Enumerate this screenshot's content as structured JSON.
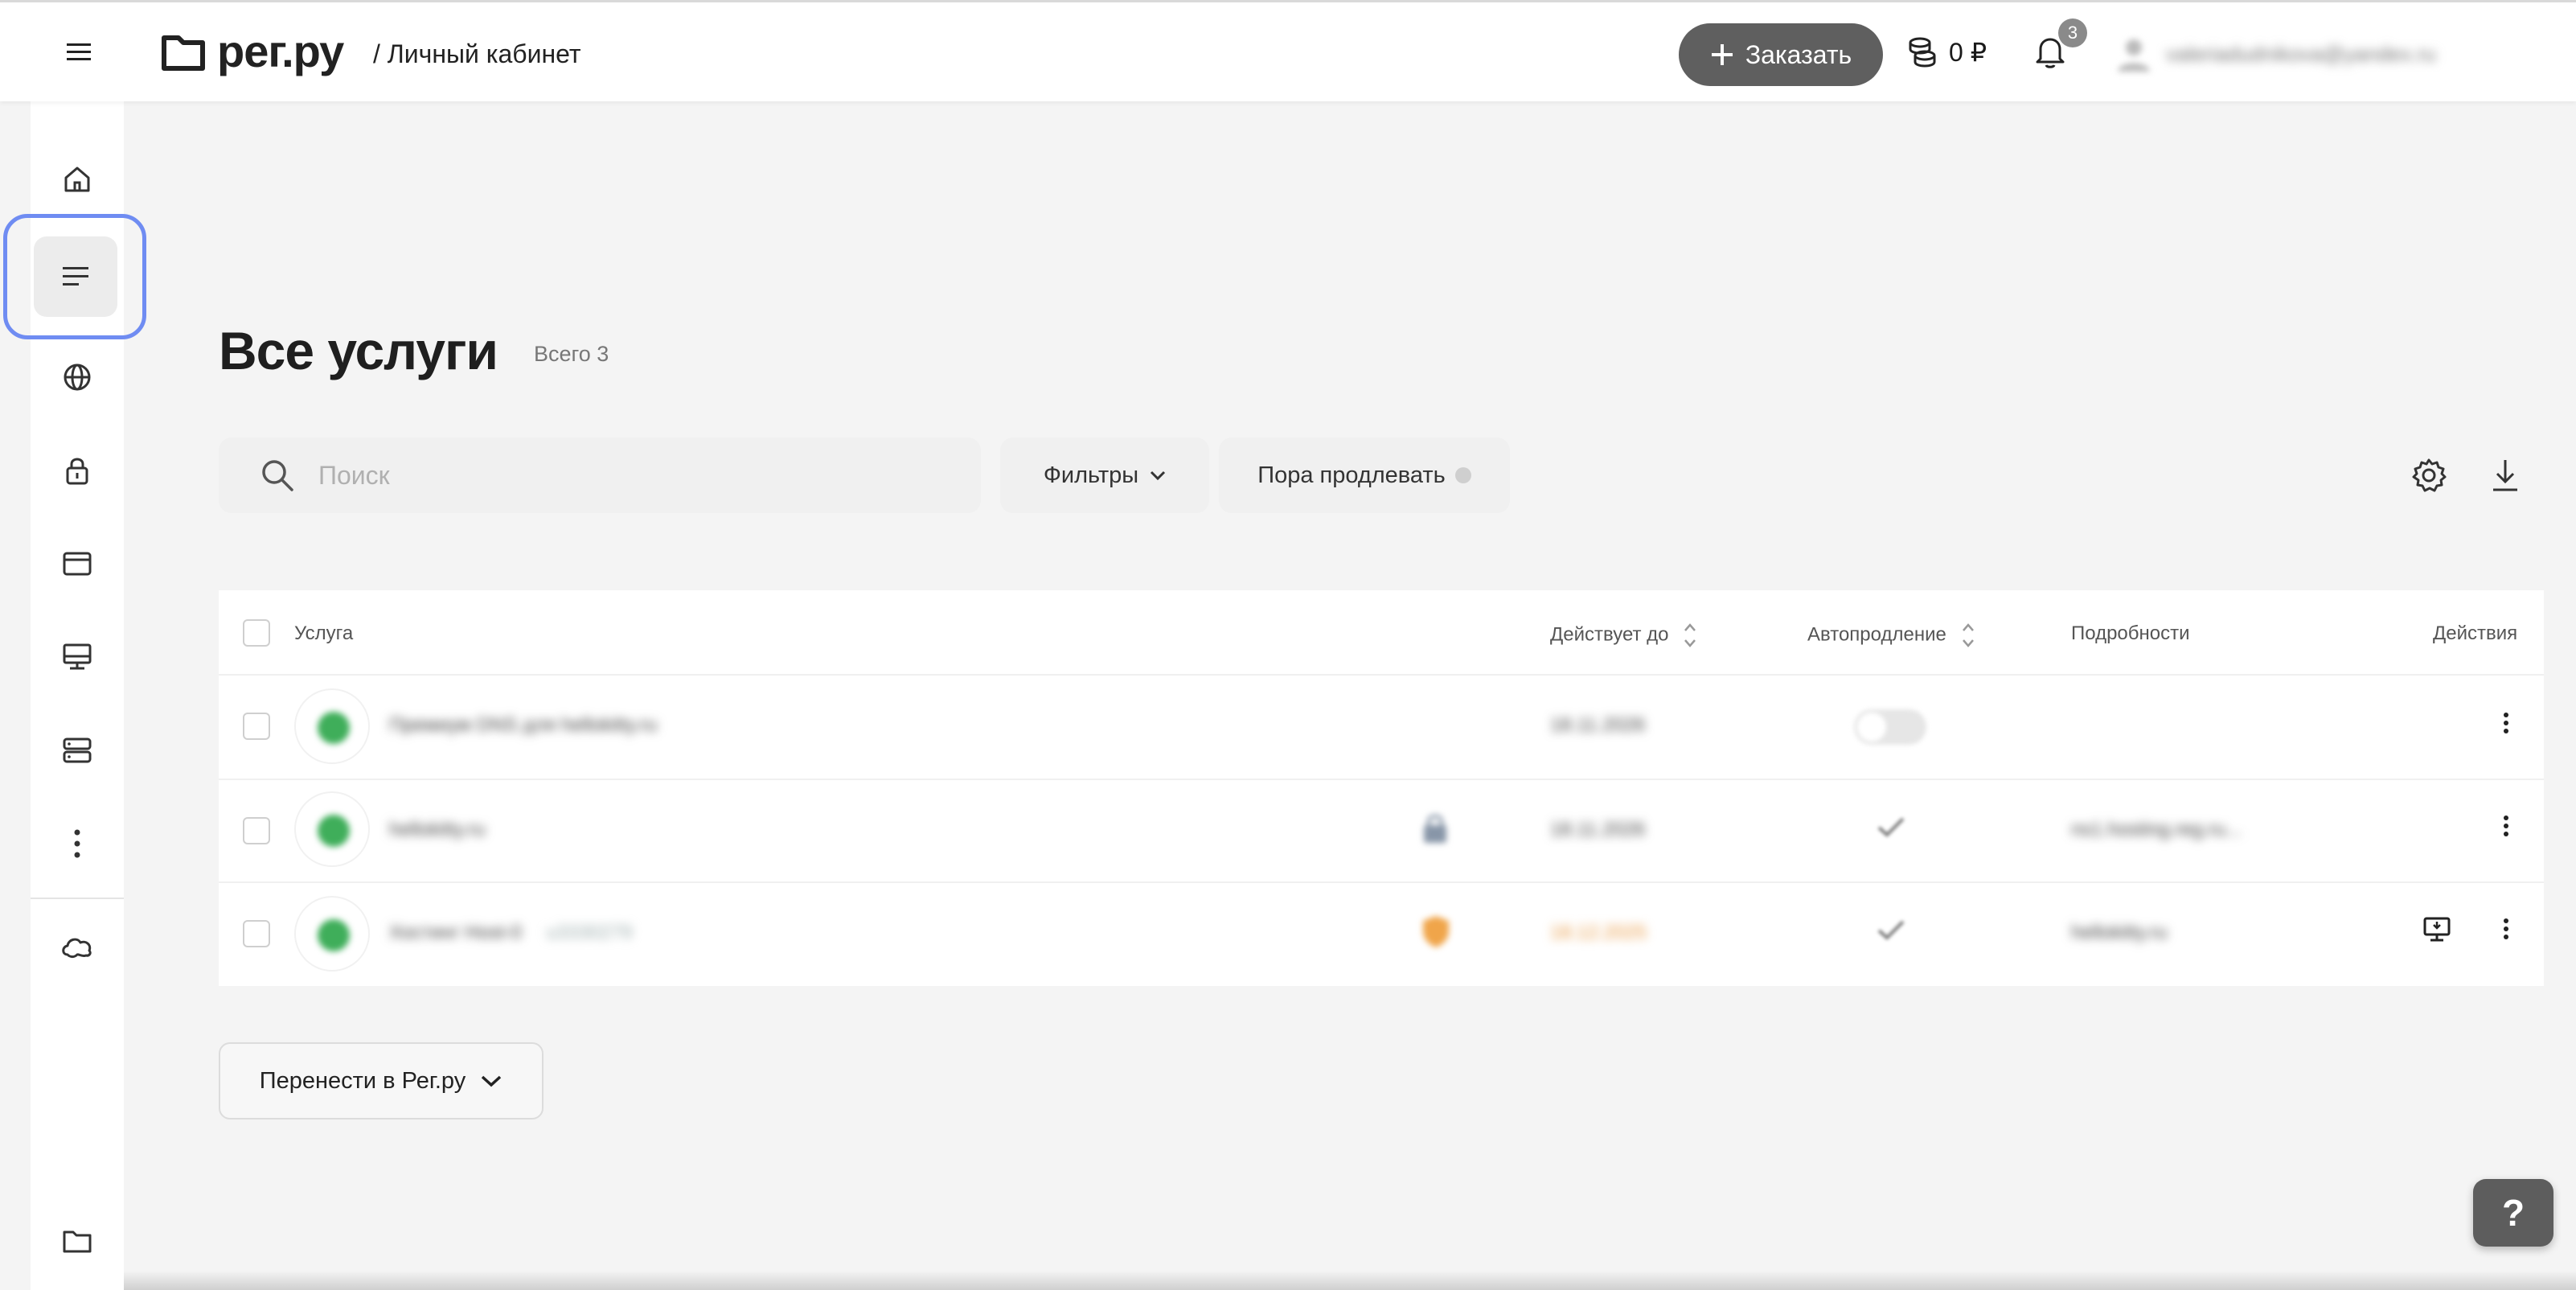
{
  "header": {
    "logo_text": "рег.ру",
    "section": "/ Личный кабинет",
    "order_label": "Заказать",
    "balance": "0 ₽",
    "notifications_count": "3",
    "user_email": "valeriadudnikova@yandex.ru"
  },
  "sidebar": {
    "items": [
      {
        "name": "home-icon"
      },
      {
        "name": "services-list-icon",
        "active": true
      },
      {
        "name": "globe-icon"
      },
      {
        "name": "lock-icon"
      },
      {
        "name": "browser-window-icon"
      },
      {
        "name": "monitor-icon"
      },
      {
        "name": "server-icon"
      },
      {
        "name": "more-vertical-icon"
      },
      {
        "name": "cloud-icon"
      },
      {
        "name": "folder-icon"
      }
    ]
  },
  "page": {
    "title": "Все услуги",
    "total": "Всего 3"
  },
  "toolbar": {
    "search_placeholder": "Поиск",
    "filters_label": "Фильтры",
    "renew_label": "Пора продлевать"
  },
  "table": {
    "columns": {
      "service": "Услуга",
      "valid_until": "Действует до",
      "autorenew": "Автопродление",
      "details": "Подробности",
      "actions": "Действия"
    },
    "rows": [
      {
        "service": "Премиум DNS для hellokitty.ru",
        "extra": "",
        "valid_until": "18.11.2026",
        "autorenew": "toggle-off",
        "details": "",
        "accent": "#3fae5a",
        "date_color": "#444444"
      },
      {
        "service": "hellokitty.ru",
        "extra": "",
        "valid_until": "18.11.2026",
        "autorenew": "check",
        "details": "ns1.hosting.reg.ru...",
        "accent": "#3fae5a",
        "date_color": "#444444"
      },
      {
        "service": "Хостинг Host-0",
        "extra": "u3330279",
        "valid_until": "18.12.2025",
        "autorenew": "check",
        "details": "hellokitty.ru",
        "accent": "#3fae5a",
        "date_color": "#e8963c"
      }
    ]
  },
  "transfer_label": "Перенести в Рег.ру",
  "help_label": "?",
  "colors": {
    "accent_ring": "#6f8cf2",
    "order_button": "#5f5f5f",
    "warning": "#e8963c"
  }
}
